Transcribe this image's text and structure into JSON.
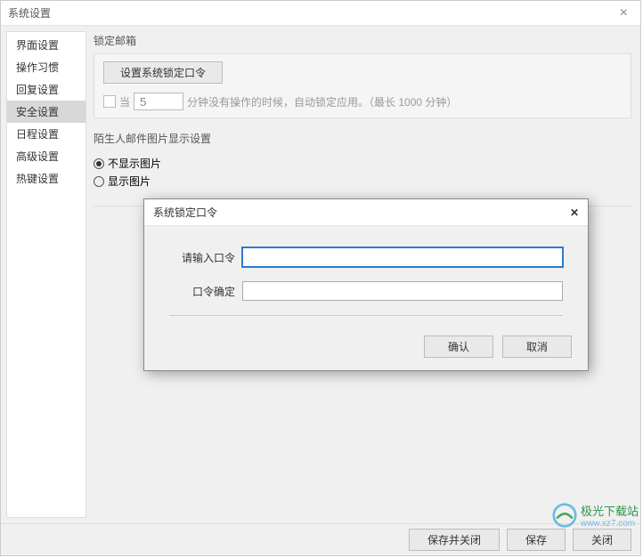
{
  "window": {
    "title": "系统设置"
  },
  "sidebar": {
    "items": [
      {
        "label": "界面设置"
      },
      {
        "label": "操作习惯"
      },
      {
        "label": "回复设置"
      },
      {
        "label": "安全设置"
      },
      {
        "label": "日程设置"
      },
      {
        "label": "高级设置"
      },
      {
        "label": "热键设置"
      }
    ],
    "selectedIndex": 3
  },
  "lock": {
    "groupLabel": "锁定邮箱",
    "setPasswordBtn": "设置系统锁定口令",
    "checkboxPrefix": "当",
    "minuteValue": "5",
    "suffix": "分钟没有操作的时候，自动锁定应用。（最长 1000 分钟）"
  },
  "stranger": {
    "groupLabel": "陌生人邮件图片显示设置",
    "optHide": "不显示图片",
    "optShow": "显示图片"
  },
  "footer": {
    "saveClose": "保存并关闭",
    "save": "保存",
    "close": "关闭"
  },
  "modal": {
    "title": "系统锁定口令",
    "pwdLabel": "请输入口令",
    "confirmLabel": "口令确定",
    "ok": "确认",
    "cancel": "取消"
  },
  "watermark": {
    "brand": "极光下载站",
    "url": "www.xz7.com"
  }
}
